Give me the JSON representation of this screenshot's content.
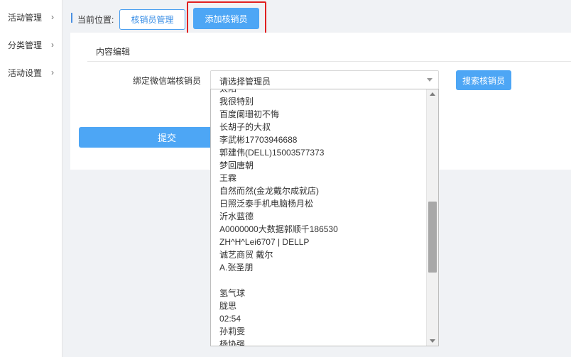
{
  "sidebar": {
    "items": [
      {
        "label": "活动管理",
        "chevron": "›"
      },
      {
        "label": "分类管理",
        "chevron": "›"
      },
      {
        "label": "活动设置",
        "chevron": "›"
      }
    ]
  },
  "breadcrumb": {
    "label": "当前位置:",
    "manage_button": "核销员管理",
    "add_button": "添加核销员"
  },
  "panel": {
    "title": "内容编辑",
    "field_label": "绑定微信端核销员",
    "select_value": "请选择管理员",
    "search_button": "搜索核销员",
    "submit_button": "提交"
  },
  "dropdown": {
    "options": [
      "太阳",
      "我很特别",
      "百度阑珊初不悔",
      "长胡子的大叔",
      "李武彬17703946688",
      "郭建伟(DELL)15003577373",
      "梦回唐朝",
      "王霖",
      "自然而然(金龙戴尔成就店)",
      "日照泛泰手机电脑杨月松",
      "沂水蓝德",
      "A0000000大数据郭顺千186530",
      "ZH^H^Lei6707 | DELLP",
      "诚艺商贸 戴尔",
      "A.张圣朋",
      "",
      "氢气球",
      "胧思",
      "02:54",
      "孙莉雯",
      "杨协强"
    ]
  },
  "colors": {
    "accent": "#4da6f5",
    "highlight": "#e02020"
  }
}
